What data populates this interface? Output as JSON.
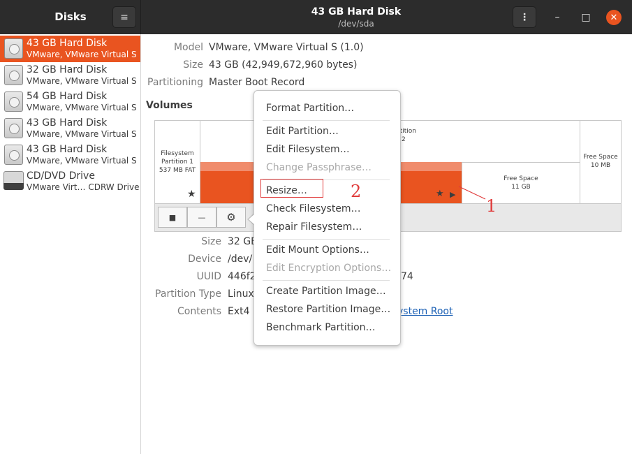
{
  "header": {
    "sidebar_title": "Disks",
    "title": "43 GB Hard Disk",
    "subtitle": "/dev/sda",
    "hamburger_icon": "≡",
    "kebab_icon": "⋮",
    "minimize_icon": "–",
    "maximize_icon": "□",
    "close_icon": "✕"
  },
  "sidebar": {
    "items": [
      {
        "name": "43 GB Hard Disk",
        "sub": "VMware, VMware Virtual S"
      },
      {
        "name": "32 GB Hard Disk",
        "sub": "VMware, VMware Virtual S"
      },
      {
        "name": "54 GB Hard Disk",
        "sub": "VMware, VMware Virtual S"
      },
      {
        "name": "43 GB Hard Disk",
        "sub": "VMware, VMware Virtual S"
      },
      {
        "name": "43 GB Hard Disk",
        "sub": "VMware, VMware Virtual S"
      },
      {
        "name": "CD/DVD Drive",
        "sub": "VMware Virt… CDRW Drive"
      }
    ]
  },
  "disk_info": {
    "model_label": "Model",
    "model": "VMware, VMware Virtual S (1.0)",
    "size_label": "Size",
    "size": "43 GB (42,949,672,960 bytes)",
    "partitioning_label": "Partitioning",
    "partitioning": "Master Boot Record"
  },
  "volumes": {
    "title": "Volumes",
    "seg1_line1": "Filesystem",
    "seg1_line2": "Partition 1",
    "seg1_line3": "537 MB FAT",
    "seg2_line1": "rtition",
    "seg2_line2": "2",
    "free1_line1": "Free Space",
    "free1_line2": "11 GB",
    "free2_line1": "Free Space",
    "free2_line2": "10 MB",
    "star_icon": "★",
    "play_icon": "▶",
    "stop_icon": "■",
    "minus_icon": "—",
    "gears_icon": "⚙"
  },
  "partition_info": {
    "size_label": "Size",
    "size": "32 GB",
    "device_label": "Device",
    "device": "/dev/",
    "uuid_label": "UUID",
    "uuid": "446f2",
    "uuid_tail": "74",
    "type_label": "Partition Type",
    "type": "Linux",
    "contents_label": "Contents",
    "contents": "Ext4 (",
    "contents_link": "ystem Root"
  },
  "menu": {
    "items": [
      {
        "label": "Format Partition…",
        "enabled": true
      },
      {
        "label": "Edit Partition…",
        "enabled": true
      },
      {
        "label": "Edit Filesystem…",
        "enabled": true
      },
      {
        "label": "Change Passphrase…",
        "enabled": false
      },
      {
        "label": "Resize…",
        "enabled": true
      },
      {
        "label": "Check Filesystem…",
        "enabled": true
      },
      {
        "label": "Repair Filesystem…",
        "enabled": true
      },
      {
        "label": "Edit Mount Options…",
        "enabled": true
      },
      {
        "label": "Edit Encryption Options…",
        "enabled": false
      },
      {
        "label": "Create Partition Image…",
        "enabled": true
      },
      {
        "label": "Restore Partition Image…",
        "enabled": true
      },
      {
        "label": "Benchmark Partition…",
        "enabled": true
      }
    ]
  },
  "annotations": {
    "marker1": "1",
    "marker2": "2",
    "color": "#e03a3a"
  },
  "colors": {
    "accent": "#e95420",
    "headerbar": "#2c2c2c"
  }
}
